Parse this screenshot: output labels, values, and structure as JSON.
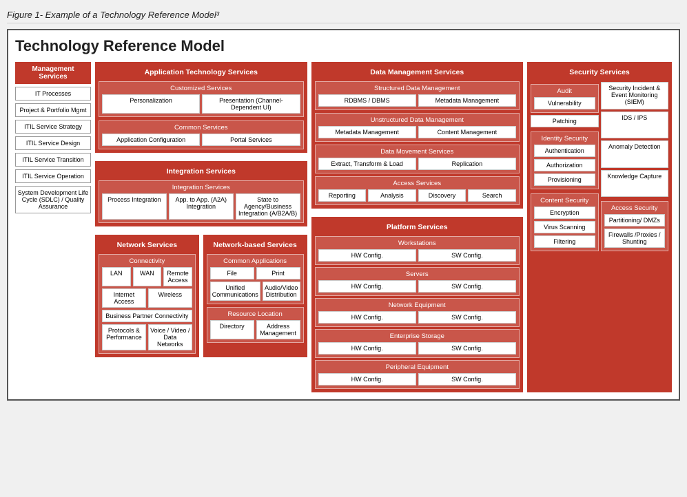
{
  "page": {
    "title": "Figure 1- Example of a Technology Reference Model³",
    "diagram_title": "Technology Reference Model"
  },
  "management": {
    "header": "Management Services",
    "items": [
      "IT Processes",
      "Project & Portfolio Mgmt",
      "ITIL Service Strategy",
      "ITIL Service Design",
      "ITIL Service Transition",
      "ITIL Service Operation",
      "System Development Life Cycle (SDLC) / Quality Assurance"
    ]
  },
  "app_tech": {
    "header": "Application Technology Services",
    "customized": {
      "label": "Customized Services",
      "items": [
        "Personalization",
        "Presentation (Channel-Dependent UI)"
      ]
    },
    "common": {
      "label": "Common Services",
      "items": [
        "Application Configuration",
        "Portal Services"
      ]
    }
  },
  "integration": {
    "header": "Integration Services",
    "sub": "Integration Services",
    "items": [
      "Process Integration",
      "App. to App. (A2A) Integration",
      "State to Agency/Business Integration (A/B2A/B)"
    ]
  },
  "network": {
    "header": "Network Services",
    "connectivity_label": "Connectivity",
    "connectivity_items": [
      "LAN",
      "WAN",
      "Remote Access",
      "Internet Access",
      "Wireless",
      "Business Partner Connectivity",
      "Protocols & Performance",
      "Voice / Video / Data Networks"
    ]
  },
  "network_based": {
    "header": "Network-based Services",
    "common_apps_label": "Common Applications",
    "common_apps": [
      "File",
      "Print",
      "Unified Communications",
      "Audio/Video Distribution"
    ],
    "resource_location_label": "Resource Location",
    "resource_location": [
      "Directory",
      "Address Management"
    ]
  },
  "data_mgmt": {
    "header": "Data Management Services",
    "structured_label": "Structured Data Management",
    "structured": [
      "RDBMS / DBMS",
      "Metadata Management"
    ],
    "unstructured_label": "Unstructured Data Management",
    "unstructured": [
      "Metadata Management",
      "Content Management"
    ],
    "movement_label": "Data Movement Services",
    "movement": [
      "Extract, Transform & Load",
      "Replication"
    ],
    "access_label": "Access Services",
    "access": [
      "Reporting",
      "Analysis",
      "Discovery",
      "Search"
    ]
  },
  "platform": {
    "header": "Platform Services",
    "workstations_label": "Workstations",
    "workstations": [
      "HW Config.",
      "SW Config."
    ],
    "servers_label": "Servers",
    "servers": [
      "HW Config.",
      "SW Config."
    ],
    "network_equip_label": "Network Equipment",
    "network_equip": [
      "HW Config.",
      "SW Config."
    ],
    "enterprise_storage_label": "Enterprise Storage",
    "enterprise_storage": [
      "HW Config.",
      "SW Config."
    ],
    "peripheral_label": "Peripheral Equipment",
    "peripheral": [
      "HW Config.",
      "SW Config."
    ]
  },
  "security": {
    "header": "Security Services",
    "col1": {
      "items": [
        {
          "label": "Audit",
          "sub": "Vulnerability"
        },
        {
          "label": "Patching"
        },
        {
          "label": "Identity Security"
        },
        {
          "label": "Authentication"
        },
        {
          "label": "Authorization"
        },
        {
          "label": "Provisioning"
        },
        {
          "label": "Content Security"
        },
        {
          "label": "Encryption"
        },
        {
          "label": "Virus Scanning"
        },
        {
          "label": "Filtering"
        }
      ]
    },
    "col2": {
      "items": [
        {
          "label": "Security Incident & Event Monitoring (SIEM)"
        },
        {
          "label": "IDS / IPS"
        },
        {
          "label": "Anomaly Detection"
        },
        {
          "label": "Knowledge Capture"
        },
        {
          "label": "Access Security"
        },
        {
          "label": "Partitioning/ DMZs"
        },
        {
          "label": "Firewalls /Proxies / Shunting"
        }
      ]
    }
  }
}
